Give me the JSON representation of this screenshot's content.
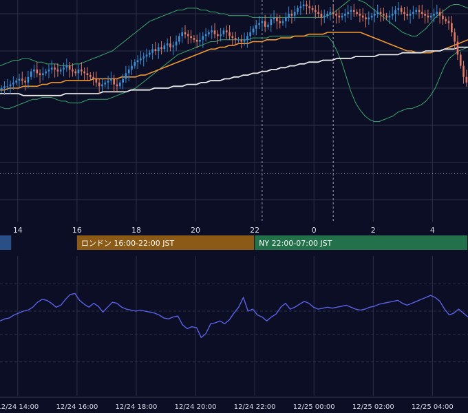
{
  "colors": {
    "background": "#0b0e24",
    "grid": "#2c3148",
    "candle_up": "#3d8fd6",
    "candle_down": "#e07a66",
    "ma_fast": "#f29a33",
    "ma_slow": "#ececec",
    "bollinger": "#3aa66b",
    "oscillator": "#5b62e8",
    "session_tokyo": "#2a4f86",
    "session_london": "#8a5a16",
    "session_ny": "#23714a"
  },
  "sessions": [
    {
      "label": "",
      "start_hour": 8,
      "end_hour": 13.8,
      "color": "#2a4f86",
      "text_color": "#ffffff"
    },
    {
      "label": "ロンドン 16:00-22:00 JST",
      "start_hour": 16,
      "end_hour": 22,
      "color": "#8a5a16",
      "text_color": "#ffffff"
    },
    {
      "label": "NY 22:00-07:00 JST",
      "start_hour": 22,
      "end_hour": 31,
      "color": "#23714a",
      "text_color": "#ffffff"
    }
  ],
  "chart_data": [
    {
      "type": "candlestick",
      "title": "",
      "x_unit": "hours since 12/24 00:00 JST",
      "x_range": [
        13.4,
        29.2
      ],
      "y_range": [
        0,
        100
      ],
      "x_tick_labels": [
        {
          "hour": 14,
          "label": "14"
        },
        {
          "hour": 16,
          "label": "16"
        },
        {
          "hour": 18,
          "label": "18"
        },
        {
          "hour": 20,
          "label": "20"
        },
        {
          "hour": 22,
          "label": "22"
        },
        {
          "hour": 24,
          "label": "0"
        },
        {
          "hour": 26,
          "label": "2"
        },
        {
          "hour": 28,
          "label": "4"
        }
      ],
      "vertical_markers": [
        {
          "hour": 22.25,
          "style": "dotted"
        },
        {
          "hour": 24.65,
          "style": "dotted"
        }
      ],
      "horizontal_markers": [
        {
          "y": 14,
          "style": "dotted"
        }
      ],
      "candles_start_hour": 13.4,
      "candle_interval_hours": 0.1,
      "close_series": [
        60,
        61,
        61,
        62,
        63,
        64,
        65,
        64,
        63,
        66,
        69,
        70,
        68,
        67,
        68,
        69,
        70,
        71,
        70,
        69,
        70,
        71,
        72,
        70,
        69,
        68,
        70,
        69,
        68,
        67,
        66,
        65,
        63,
        61,
        62,
        63,
        64,
        65,
        62,
        61,
        63,
        65,
        68,
        70,
        72,
        74,
        75,
        76,
        77,
        78,
        79,
        81,
        80,
        82,
        81,
        83,
        84,
        82,
        83,
        85,
        88,
        90,
        89,
        88,
        87,
        86,
        85,
        86,
        88,
        89,
        90,
        91,
        89,
        88,
        89,
        91,
        90,
        88,
        87,
        86,
        86,
        85,
        86,
        88,
        90,
        92,
        94,
        95,
        96,
        93,
        94,
        97,
        98,
        96,
        95,
        96,
        98,
        100,
        99,
        101,
        103,
        104,
        105,
        104,
        103,
        102,
        101,
        100,
        98,
        99,
        100,
        101,
        100,
        99,
        98,
        99,
        100,
        101,
        102,
        101,
        100,
        99,
        98,
        97,
        98,
        99,
        100,
        101,
        100,
        99,
        98,
        99,
        100,
        102,
        103,
        101,
        100,
        99,
        100,
        101,
        102,
        101,
        100,
        99,
        98,
        99,
        100,
        101,
        99,
        97,
        96,
        95,
        90,
        85,
        78,
        72,
        66,
        63,
        62,
        63,
        64,
        63,
        62,
        61,
        63,
        65,
        71,
        82,
        90,
        92,
        88,
        80,
        74,
        76,
        83,
        86,
        88,
        90,
        91,
        92,
        93,
        94,
        92,
        90,
        88,
        94,
        96,
        98,
        100,
        102
      ],
      "series": [
        {
          "name": "",
          "kind": "ma_fast",
          "values": [
            59,
            59,
            60,
            60,
            60,
            61,
            61,
            61,
            61,
            62,
            62,
            63,
            63,
            63,
            64,
            64,
            64,
            64,
            64,
            64,
            65,
            65,
            65,
            65,
            65,
            65,
            66,
            66,
            66,
            66,
            67,
            67,
            68,
            69,
            70,
            71,
            72,
            73,
            74,
            75,
            76,
            77,
            78,
            79,
            80,
            81,
            81,
            82,
            82,
            83,
            83,
            84,
            84,
            84,
            85,
            85,
            85,
            86,
            86,
            86,
            87,
            87,
            87,
            88,
            88,
            88,
            89,
            89,
            89,
            89,
            90,
            90,
            90,
            90,
            90,
            90,
            90,
            90,
            89,
            88,
            87,
            86,
            85,
            84,
            83,
            82,
            81,
            80,
            80,
            79,
            79,
            79,
            79,
            80,
            80,
            81,
            82,
            83,
            84,
            85,
            86
          ]
        },
        {
          "name": "",
          "kind": "ma_slow",
          "values": [
            57,
            57,
            57,
            57,
            57,
            56,
            56,
            56,
            56,
            56,
            56,
            56,
            56,
            56,
            57,
            57,
            57,
            57,
            57,
            57,
            57,
            57,
            58,
            58,
            58,
            58,
            58,
            58,
            59,
            59,
            59,
            59,
            59,
            60,
            60,
            60,
            60,
            61,
            61,
            61,
            62,
            62,
            62,
            63,
            63,
            64,
            64,
            64,
            65,
            65,
            66,
            66,
            67,
            67,
            68,
            68,
            69,
            69,
            70,
            70,
            71,
            71,
            72,
            72,
            73,
            73,
            74,
            74,
            74,
            75,
            75,
            75,
            76,
            76,
            76,
            76,
            77,
            77,
            77,
            77,
            77,
            78,
            78,
            78,
            78,
            78,
            79,
            79,
            79,
            79,
            79,
            80,
            80,
            80,
            80,
            81,
            81,
            81,
            82,
            82,
            82
          ]
        },
        {
          "name": "",
          "kind": "bollinger_upper",
          "values": [
            72,
            73,
            74,
            75,
            75,
            76,
            76,
            75,
            74,
            74,
            73,
            73,
            73,
            72,
            72,
            72,
            73,
            73,
            74,
            75,
            76,
            77,
            78,
            79,
            80,
            82,
            84,
            86,
            88,
            90,
            92,
            94,
            96,
            97,
            98,
            99,
            100,
            101,
            102,
            102,
            103,
            103,
            103,
            102,
            102,
            101,
            101,
            100,
            100,
            99,
            99,
            99,
            99,
            99,
            98,
            98,
            98,
            98,
            98,
            98,
            98,
            98,
            98,
            98,
            98,
            98,
            98,
            98,
            98,
            98,
            99,
            100,
            102,
            104,
            106,
            108,
            108,
            107,
            106,
            104,
            102,
            100,
            98,
            96,
            94,
            92,
            90,
            89,
            88,
            88,
            90,
            92,
            95,
            98,
            100,
            102,
            104,
            105,
            105,
            104,
            103
          ]
        },
        {
          "name": "",
          "kind": "bollinger_lower",
          "values": [
            50,
            49,
            49,
            50,
            51,
            52,
            53,
            54,
            54,
            55,
            55,
            55,
            54,
            53,
            53,
            52,
            52,
            52,
            53,
            54,
            54,
            54,
            54,
            54,
            55,
            56,
            57,
            58,
            59,
            60,
            62,
            64,
            66,
            68,
            70,
            72,
            74,
            76,
            78,
            79,
            80,
            81,
            82,
            83,
            84,
            85,
            85,
            86,
            86,
            86,
            86,
            86,
            86,
            86,
            87,
            87,
            87,
            87,
            88,
            88,
            88,
            88,
            88,
            88,
            88,
            88,
            88,
            88,
            88,
            88,
            88,
            85,
            80,
            74,
            66,
            58,
            52,
            48,
            45,
            43,
            42,
            42,
            43,
            44,
            45,
            47,
            48,
            49,
            49,
            50,
            51,
            53,
            56,
            60,
            66,
            72,
            76,
            78,
            80,
            81,
            82
          ]
        }
      ]
    },
    {
      "type": "line",
      "title": "",
      "x_range": [
        13.4,
        29.2
      ],
      "y_range": [
        0,
        100
      ],
      "grid_levels": [
        90,
        62,
        38,
        10
      ],
      "x_tick_labels": [
        {
          "hour": 14,
          "label": "12/24 14:00"
        },
        {
          "hour": 16,
          "label": "12/24 16:00"
        },
        {
          "hour": 18,
          "label": "12/24 18:00"
        },
        {
          "hour": 20,
          "label": "12/24 20:00"
        },
        {
          "hour": 22,
          "label": "12/24 22:00"
        },
        {
          "hour": 24,
          "label": "12/25 00:00"
        },
        {
          "hour": 26,
          "label": "12/25 02:00"
        },
        {
          "hour": 28,
          "label": "12/25 04:00"
        }
      ],
      "series": [
        {
          "name": "",
          "kind": "oscillator",
          "values": [
            52,
            54,
            55,
            58,
            60,
            62,
            63,
            66,
            71,
            74,
            73,
            70,
            66,
            68,
            74,
            79,
            80,
            73,
            69,
            66,
            70,
            67,
            61,
            66,
            71,
            70,
            66,
            64,
            63,
            62,
            63,
            62,
            61,
            60,
            58,
            55,
            54,
            56,
            57,
            48,
            44,
            46,
            45,
            35,
            39,
            49,
            50,
            52,
            49,
            53,
            60,
            66,
            76,
            62,
            64,
            58,
            56,
            52,
            56,
            59,
            66,
            70,
            64,
            66,
            69,
            72,
            70,
            66,
            64,
            65,
            66,
            65,
            66,
            67,
            68,
            66,
            64,
            63,
            64,
            66,
            67,
            69,
            70,
            71,
            72,
            73,
            70,
            68,
            70,
            72,
            74,
            76,
            78,
            76,
            72,
            64,
            58,
            60,
            64,
            60,
            56
          ]
        }
      ]
    }
  ]
}
